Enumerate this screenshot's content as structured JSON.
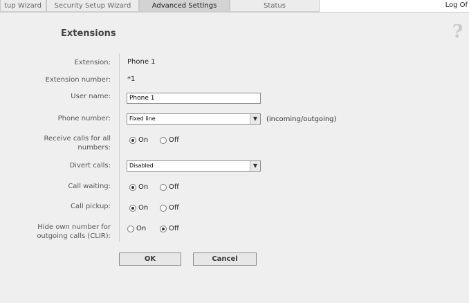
{
  "tabs": [
    {
      "label": "tup Wizard"
    },
    {
      "label": "Security Setup Wizard"
    },
    {
      "label": "Advanced Settings"
    },
    {
      "label": "Status"
    }
  ],
  "logoff_label": "Log Of",
  "page": {
    "title": "Extensions",
    "help_icon": "question-mark-icon"
  },
  "form": {
    "extension": {
      "label": "Extension:",
      "value": "Phone 1"
    },
    "extension_number": {
      "label": "Extension number:",
      "value": "*1"
    },
    "user_name": {
      "label": "User name:",
      "value": "Phone 1"
    },
    "phone_number": {
      "label": "Phone number:",
      "selected": "Fixed line",
      "hint": "(incoming/outgoing)"
    },
    "receive_calls": {
      "label_line1": "Receive calls for all",
      "label_line2": "numbers:",
      "on": "On",
      "off": "Off",
      "selected": "on"
    },
    "divert_calls": {
      "label": "Divert calls:",
      "selected": "Disabled"
    },
    "call_waiting": {
      "label": "Call waiting:",
      "on": "On",
      "off": "Off",
      "selected": "on"
    },
    "call_pickup": {
      "label": "Call pickup:",
      "on": "On",
      "off": "Off",
      "selected": "on"
    },
    "clir": {
      "label_line1": "Hide own number for",
      "label_line2": "outgoing calls (CLIR):",
      "on": "On",
      "off": "Off",
      "selected": "off"
    }
  },
  "buttons": {
    "ok": "OK",
    "cancel": "Cancel"
  }
}
